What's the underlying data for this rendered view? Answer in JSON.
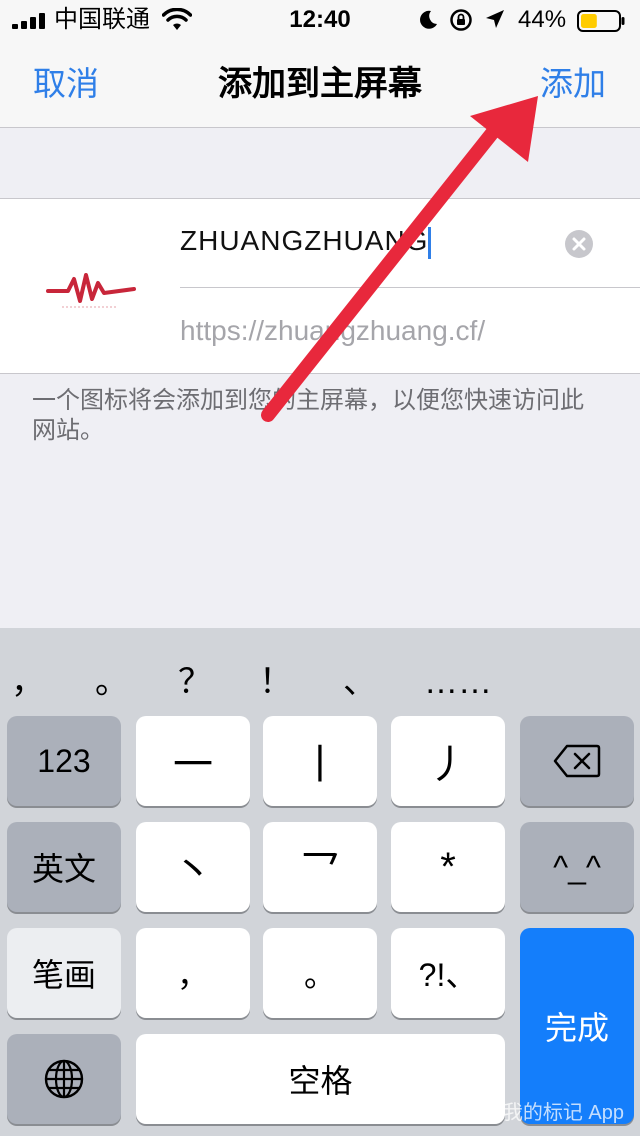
{
  "status_bar": {
    "carrier": "中国联通",
    "time": "12:40",
    "battery_percent": "44%",
    "battery_level": 0.44,
    "battery_color": "#ffcc00"
  },
  "nav": {
    "cancel_label": "取消",
    "title": "添加到主屏幕",
    "add_label": "添加",
    "accent_color": "#2f7fe8"
  },
  "form": {
    "site_icon": "waveform-logo-icon",
    "name_value": "ZHUANGZHUANG",
    "url": "https://zhuangzhuang.cf/",
    "caption": "一个图标将会添加到您的主屏幕，以便您快速访问此网站。"
  },
  "keyboard": {
    "suggestions": [
      "，",
      "。",
      "？",
      "！",
      "、",
      "……"
    ],
    "row1": {
      "left": "123",
      "keys": [
        "一",
        "丨",
        "丿"
      ],
      "right": "delete-icon"
    },
    "row2": {
      "left": "英文",
      "keys": [
        "丶",
        "乛",
        "*"
      ],
      "right": "^_^"
    },
    "row3": {
      "left": "笔画",
      "keys": [
        "，",
        "。",
        "?!、"
      ],
      "right": "完成"
    },
    "row4": {
      "globe": "globe-icon",
      "space": "空格"
    }
  },
  "annotation": {
    "arrow_color": "#e8283c"
  },
  "watermark": "iMark · 我的标记 App"
}
